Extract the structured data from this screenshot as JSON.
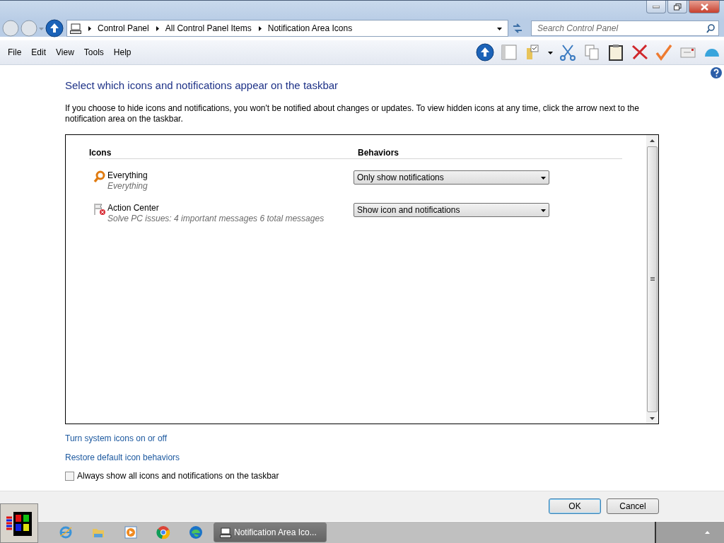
{
  "address": {
    "crumbs": [
      "Control Panel",
      "All Control Panel Items",
      "Notification Area Icons"
    ]
  },
  "search": {
    "placeholder": "Search Control Panel"
  },
  "menu": [
    "File",
    "Edit",
    "View",
    "Tools",
    "Help"
  ],
  "heading": "Select which icons and notifications appear on the taskbar",
  "description": "If you choose to hide icons and notifications, you won't be notified about changes or updates. To view hidden icons at any time, click the arrow next to the notification area on the taskbar.",
  "table": {
    "columns": [
      "Icons",
      "Behaviors"
    ],
    "rows": [
      {
        "kind": "magnifier",
        "name": "Everything",
        "subtitle": "Everything",
        "behavior": "Only show notifications"
      },
      {
        "kind": "flag",
        "name": "Action Center",
        "subtitle": "Solve PC issues: 4 important messages  6 total messages",
        "behavior": "Show icon and notifications"
      }
    ]
  },
  "links": [
    "Turn system icons on or off",
    "Restore default icon behaviors"
  ],
  "always_show": {
    "label": "Always show all icons and notifications on the taskbar",
    "checked": false
  },
  "buttons": [
    {
      "label": "OK",
      "default": true
    },
    {
      "label": "Cancel",
      "default": false
    }
  ],
  "taskbar": {
    "window_button": "Notification Area Ico..."
  }
}
